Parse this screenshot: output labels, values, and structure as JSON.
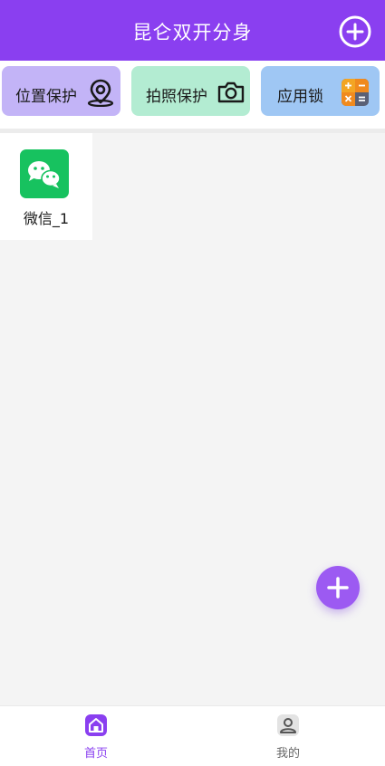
{
  "header": {
    "title": "昆仑双开分身",
    "add_icon": "plus-circle-icon"
  },
  "features": [
    {
      "label": "位置保护",
      "icon": "location-pin-icon",
      "color": "#c3b4f7"
    },
    {
      "label": "拍照保护",
      "icon": "camera-icon",
      "color": "#b3ecd2"
    },
    {
      "label": "应用锁",
      "icon": "calculator-icon",
      "color": "#9fc7f4"
    }
  ],
  "apps": [
    {
      "label": "微信_1",
      "icon": "wechat-icon"
    }
  ],
  "fab": {
    "icon": "plus-icon"
  },
  "tabbar": {
    "items": [
      {
        "label": "首页",
        "icon": "home-icon",
        "active": true,
        "color": "#8a3ff0"
      },
      {
        "label": "我的",
        "icon": "profile-icon",
        "active": false,
        "color": "#666666"
      }
    ]
  },
  "colors": {
    "accent": "#8a3ff0",
    "background": "#f4f4f4"
  }
}
